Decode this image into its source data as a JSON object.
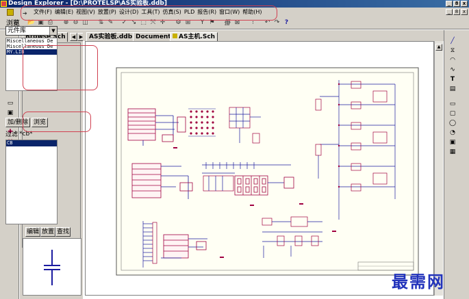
{
  "window": {
    "title": "Design Explorer - [D:\\PROTELSP\\AS实验板.ddb]",
    "buttons": [
      "_",
      "8",
      "x"
    ]
  },
  "menubar": {
    "items": [
      "文件(F)",
      "编辑(E)",
      "视图(V)",
      "放置(P)",
      "设计(D)",
      "工具(T)",
      "仿真(S)",
      "PLD",
      "报告(R)",
      "窗口(W)",
      "帮助(H)"
    ],
    "doc_buttons": [
      "_",
      "8",
      "x"
    ]
  },
  "panel": {
    "tab_label": "Browse Sch",
    "browse_label": "浏览",
    "browse_select": "元件库",
    "libraries": [
      "Miscellaneous De",
      "Miscellaneous De",
      "MY.LIB"
    ],
    "selected_library": "MY.LIB",
    "add_remove_button": "加/删除",
    "browse_button": "浏览",
    "filter_label": "过滤",
    "filter_value": "*cb*",
    "components": [
      "CB"
    ],
    "selected_component": "CB",
    "edit_button": "编辑",
    "place_button": "放置",
    "find_button": "查找"
  },
  "doc_tabs": [
    "AS实验板.ddb",
    "Documents",
    "AS主机.Sch"
  ],
  "active_tab": "AS主机.Sch",
  "watermark": "最需网",
  "colors": {
    "title_bar": "#0a246a",
    "selection": "#0a246a",
    "highlight_oval": "#d04050",
    "wire": "#1a1aa0",
    "component": "#a00040",
    "watermark": "#2233bb"
  }
}
